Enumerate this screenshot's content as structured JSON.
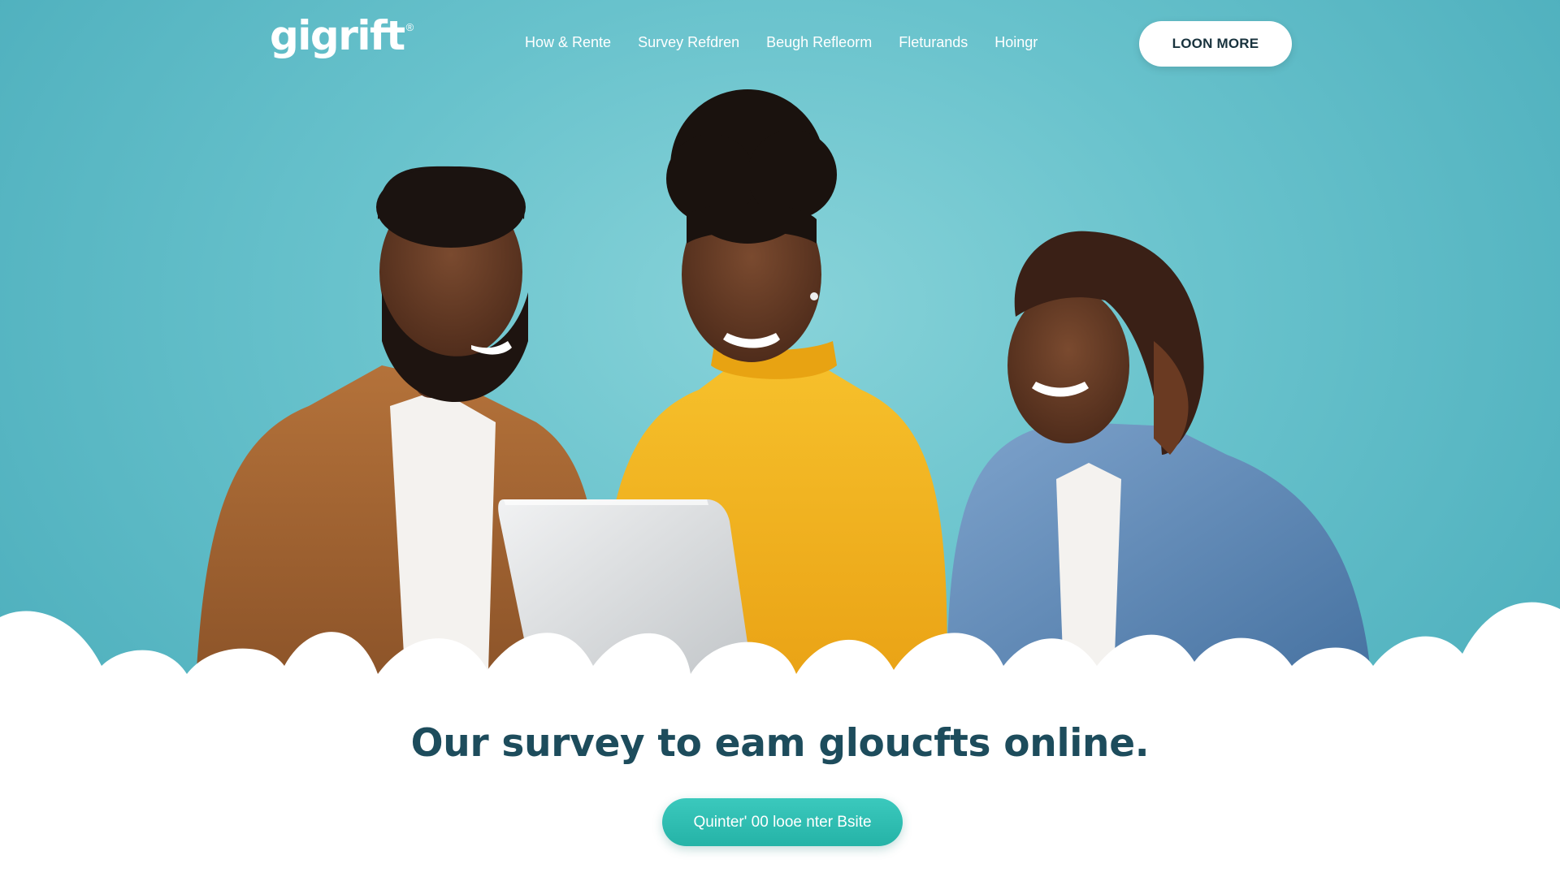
{
  "brand": {
    "name": "gigrift",
    "mark": "®"
  },
  "nav": {
    "items": [
      {
        "label": "How & Rente"
      },
      {
        "label": "Survey Refdren"
      },
      {
        "label": "Beugh Refleorm"
      },
      {
        "label": "Fleturands"
      },
      {
        "label": "Hoingr"
      }
    ],
    "login_label": "LOON MORE"
  },
  "hero": {
    "headline": "Our survey to eam gloucfts online.",
    "cta_label": "Quinter' 00 looe nter Bsite"
  },
  "colors": {
    "background_teal": "#5fbec9",
    "headline": "#1d4c5c",
    "cta": "#2bbcb0",
    "shirt_yellow": "#f2b21b",
    "jacket_brown": "#a8652f",
    "jacket_denim": "#5c88b8"
  },
  "icons": {
    "laptop": "laptop-illustration"
  }
}
